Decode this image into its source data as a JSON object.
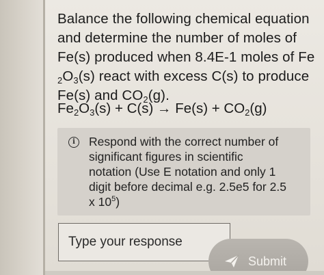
{
  "question": {
    "line1": "Balance the following chemical equation",
    "line2": "and determine the number of moles of",
    "line3": "Fe(s) produced when 8.4E-1 moles of Fe",
    "line4_sub": "2",
    "line4_o": "O",
    "line4_sub2": "3",
    "line4_rest": "(s) react with excess C(s) to produce",
    "line5_a": "Fe(s) and CO",
    "line5_sub": "2",
    "line5_b": "(g)."
  },
  "equation": {
    "fe": "Fe",
    "sub2": "2",
    "o": "O",
    "sub3": "3",
    "rest1": "(s) + C(s) → Fe(s) + CO",
    "sub_co2": "2",
    "rest2": "(g)"
  },
  "note": {
    "icon": "info-icon",
    "icon_glyph": "i",
    "line1": "Respond with the correct number of",
    "line2": "significant figures in scientific",
    "line3": "notation (Use E notation and only 1",
    "line4": "digit before decimal e.g. 2.5e5 for 2.5",
    "line5_a": "x 10",
    "line5_sup": "5",
    "line5_b": ")"
  },
  "response": {
    "placeholder": "Type your response",
    "value": ""
  },
  "submit": {
    "label": "Submit",
    "icon": "send-icon"
  }
}
